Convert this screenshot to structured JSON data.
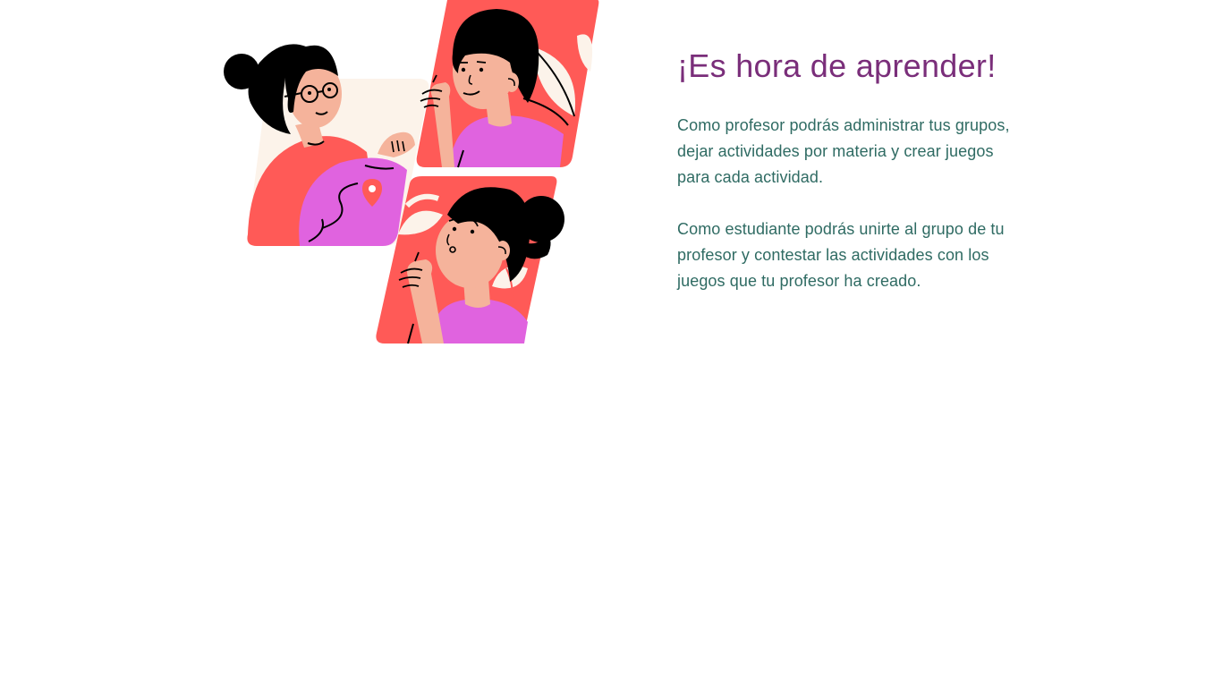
{
  "hero": {
    "title": "¡Es hora de aprender!",
    "teacher_text": "Como profesor podrás administrar tus grupos, dejar actividades por materia y crear juegos para cada actividad.",
    "student_text": "Como estudiante podrás unirte al grupo de tu profesor y contestar las actividades con los juegos que tu profesor ha creado."
  },
  "illustration": {
    "name": "teacher-and-students-illustration",
    "icon": "location-pin-icon"
  },
  "colors": {
    "title": "#7a2e7a",
    "text": "#2f6b63",
    "coral": "#ff5a57",
    "purple": "#e063df",
    "cream": "#fcf3ea",
    "skin": "#f5b39b",
    "ink": "#000000"
  }
}
